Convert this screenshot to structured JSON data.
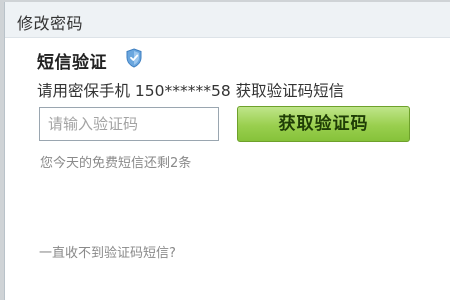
{
  "dialog": {
    "title": "修改密码"
  },
  "sms_verify": {
    "heading": "短信验证",
    "shield_icon": "shield-icon",
    "hint": "请用密保手机 150******58 获取验证码短信",
    "input_placeholder": "请输入验证码",
    "input_value": "",
    "get_code_label": "获取验证码",
    "remaining_text": "您今天的免费短信还剩2条",
    "no_sms_link": "一直收不到验证码短信?"
  },
  "colors": {
    "button_green": "#99cf4e",
    "shield_blue": "#5d9bd6"
  }
}
